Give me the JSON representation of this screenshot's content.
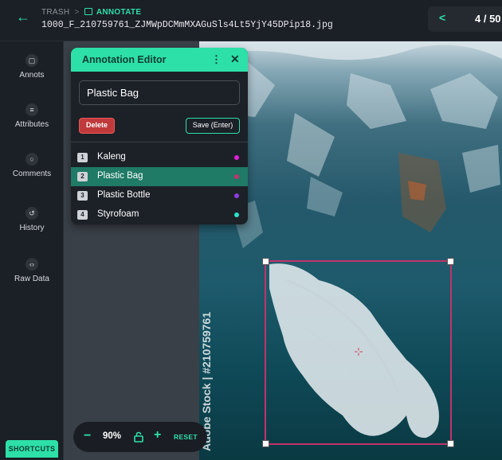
{
  "header": {
    "breadcrumb_trash": "TRASH",
    "breadcrumb_sep": ">",
    "breadcrumb_annotate": "ANNOTATE",
    "filename": "1000_F_210759761_ZJMWpDCMmMXAGuSls4Lt5YjY45DPip18.jpg",
    "page_count": "4 / 50"
  },
  "nav": {
    "items": [
      {
        "label": "Annots",
        "icon": "note-icon"
      },
      {
        "label": "Attributes",
        "icon": "list-icon"
      },
      {
        "label": "Comments",
        "icon": "comment-icon"
      },
      {
        "label": "History",
        "icon": "history-icon"
      },
      {
        "label": "Raw Data",
        "icon": "code-icon"
      }
    ],
    "shortcuts": "SHORTCUTS"
  },
  "editor": {
    "title": "Annotation Editor",
    "label_value": "Plastic Bag",
    "delete_label": "Delete",
    "save_label": "Save (Enter)",
    "classes": [
      {
        "num": "1",
        "name": "Kaleng",
        "color": "#e020d8",
        "selected": false
      },
      {
        "num": "2",
        "name": "Plastic Bag",
        "color": "#c2336b",
        "selected": true
      },
      {
        "num": "3",
        "name": "Plastic Bottle",
        "color": "#8a3ee0",
        "selected": false
      },
      {
        "num": "4",
        "name": "Styrofoam",
        "color": "#2de0c8",
        "selected": false
      }
    ]
  },
  "zoom": {
    "minus": "−",
    "value": "90%",
    "plus": "+",
    "reset": "RESET"
  },
  "photo": {
    "watermark": "Adobe Stock | #210759761"
  },
  "colors": {
    "accent": "#2de0a8",
    "bbox": "#c2336b",
    "delete": "#c0393b"
  }
}
